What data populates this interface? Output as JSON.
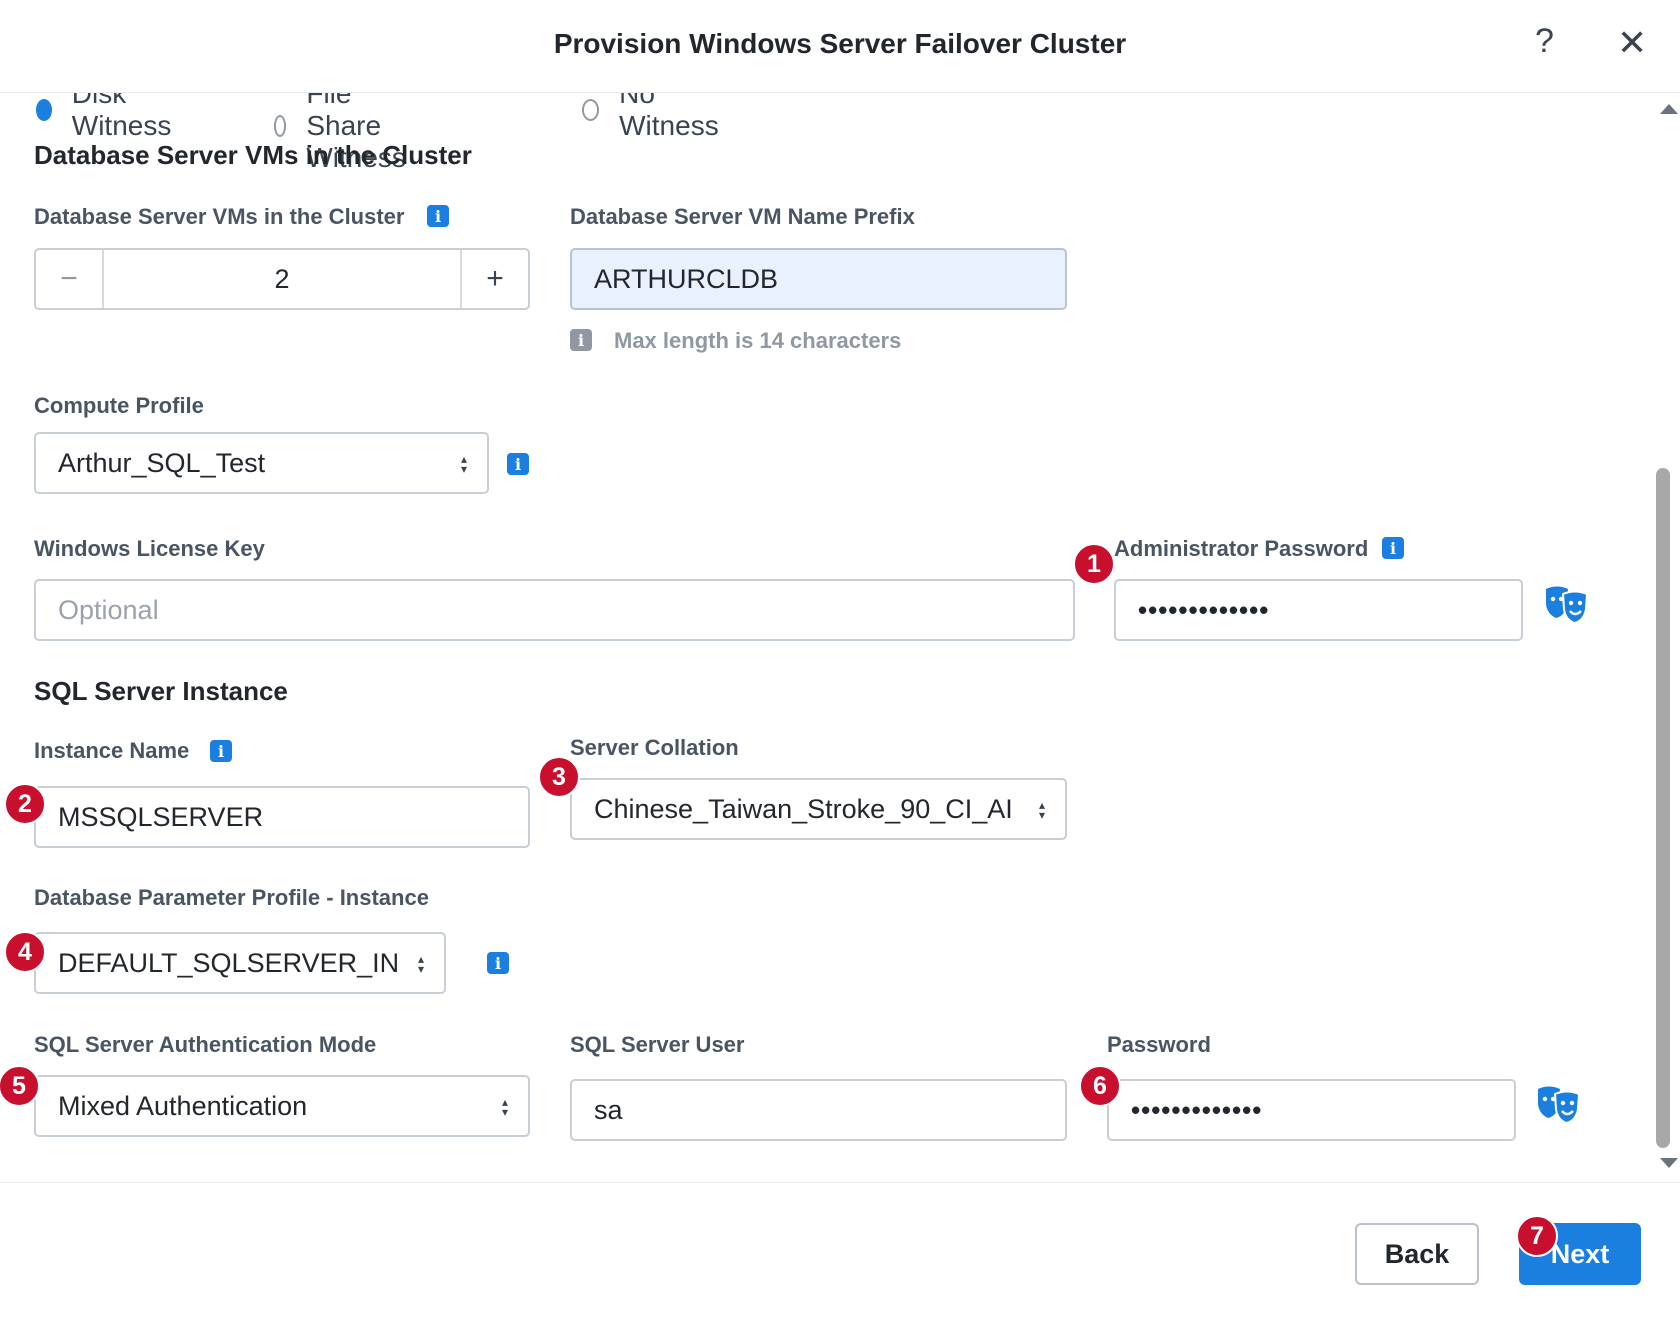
{
  "header": {
    "title": "Provision Windows Server Failover Cluster",
    "help": "?",
    "close": "✕"
  },
  "witness": {
    "options": [
      {
        "label": "Disk Witness",
        "selected": true
      },
      {
        "label": "File Share Witness",
        "selected": false
      },
      {
        "label": "No Witness",
        "selected": false
      }
    ]
  },
  "vms": {
    "section_title": "Database Server VMs in the Cluster",
    "count_label": "Database Server VMs in the Cluster",
    "count_value": "2",
    "minus": "−",
    "plus": "+",
    "prefix_label": "Database Server VM Name Prefix",
    "prefix_value": "ARTHURCLDB",
    "prefix_hint": "Max length is 14 characters"
  },
  "compute": {
    "label": "Compute Profile",
    "value": "Arthur_SQL_Test"
  },
  "license": {
    "label": "Windows License Key",
    "placeholder": "Optional"
  },
  "admin": {
    "label": "Administrator Password",
    "value": "•••••••••••••"
  },
  "sql": {
    "section_title": "SQL Server Instance",
    "instance_label": "Instance Name",
    "instance_value": "MSSQLSERVER",
    "collation_label": "Server Collation",
    "collation_value": "Chinese_Taiwan_Stroke_90_CI_AI",
    "param_label": "Database Parameter Profile - Instance",
    "param_value": "DEFAULT_SQLSERVER_INS",
    "auth_label": "SQL Server Authentication Mode",
    "auth_value": "Mixed Authentication",
    "user_label": "SQL Server User",
    "user_value": "sa",
    "password_label": "Password",
    "password_value": "•••••••••••••"
  },
  "badges": [
    "1",
    "2",
    "3",
    "4",
    "5",
    "6",
    "7"
  ],
  "footer": {
    "back": "Back",
    "next": "Next"
  },
  "colors": {
    "accent": "#1b7fe0",
    "badge": "#c8102e",
    "filled_input": "#e8f1fd"
  }
}
